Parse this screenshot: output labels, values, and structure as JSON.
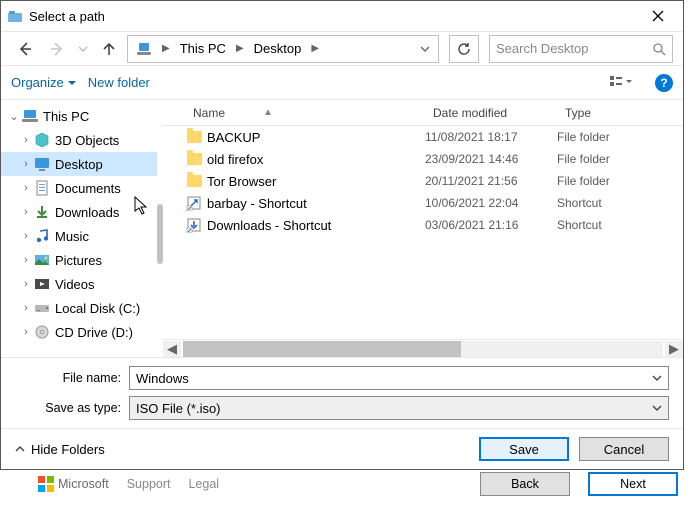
{
  "dialog": {
    "title": "Select a path"
  },
  "nav": {
    "path_segments": [
      "This PC",
      "Desktop"
    ]
  },
  "search": {
    "placeholder": "Search Desktop"
  },
  "toolbar": {
    "organize_label": "Organize",
    "newfolder_label": "New folder"
  },
  "tree": {
    "root": "This PC",
    "items": [
      "3D Objects",
      "Desktop",
      "Documents",
      "Downloads",
      "Music",
      "Pictures",
      "Videos",
      "Local Disk (C:)",
      "CD Drive (D:)"
    ],
    "selected_index": 1
  },
  "columns": {
    "name": "Name",
    "date": "Date modified",
    "type": "Type"
  },
  "rows": [
    {
      "icon": "folder",
      "name": "BACKUP",
      "date": "11/08/2021 18:17",
      "type": "File folder"
    },
    {
      "icon": "folder",
      "name": "old firefox",
      "date": "23/09/2021 14:46",
      "type": "File folder"
    },
    {
      "icon": "folder",
      "name": "Tor Browser",
      "date": "20/11/2021 21:56",
      "type": "File folder"
    },
    {
      "icon": "shortcut",
      "name": "barbay - Shortcut",
      "date": "10/06/2021 22:04",
      "type": "Shortcut"
    },
    {
      "icon": "shortcut-dl",
      "name": "Downloads - Shortcut",
      "date": "03/06/2021 21:16",
      "type": "Shortcut"
    }
  ],
  "fileform": {
    "filename_label": "File name:",
    "filename_value": "Windows",
    "saveas_label": "Save as type:",
    "saveas_value": "ISO File (*.iso)"
  },
  "buttons": {
    "hide_folders": "Hide Folders",
    "save": "Save",
    "cancel": "Cancel"
  },
  "underbar": {
    "microsoft": "Microsoft",
    "support": "Support",
    "legal": "Legal",
    "back": "Back",
    "next": "Next"
  }
}
